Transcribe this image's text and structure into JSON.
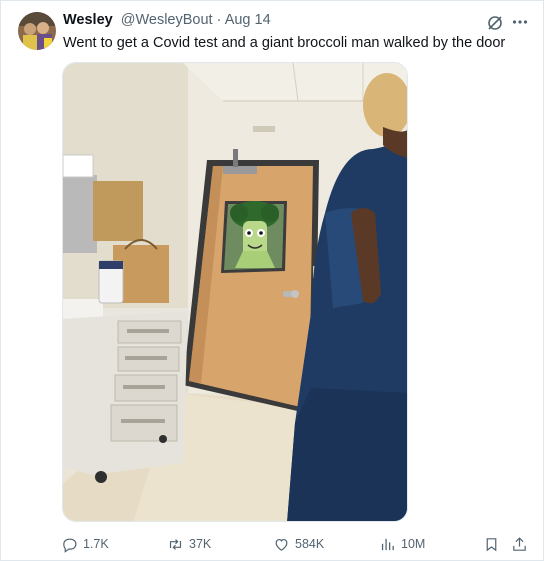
{
  "tweet": {
    "author_name": "Wesley",
    "author_handle": "@WesleyBout",
    "separator": "·",
    "date": "Aug 14",
    "text": "Went to get a Covid test and a giant broccoli man walked by the door"
  },
  "actions": {
    "replies": "1.7K",
    "retweets": "37K",
    "likes": "584K",
    "views": "10M"
  },
  "icons": {
    "reply": "reply-icon",
    "retweet": "retweet-icon",
    "like": "heart-icon",
    "views": "views-chart-icon",
    "bookmark": "bookmark-icon",
    "share": "share-icon",
    "grok": "grok-icon",
    "more": "more-icon"
  },
  "colors": {
    "text": "#0f1419",
    "muted": "#536471",
    "border": "#e1e8ed"
  }
}
